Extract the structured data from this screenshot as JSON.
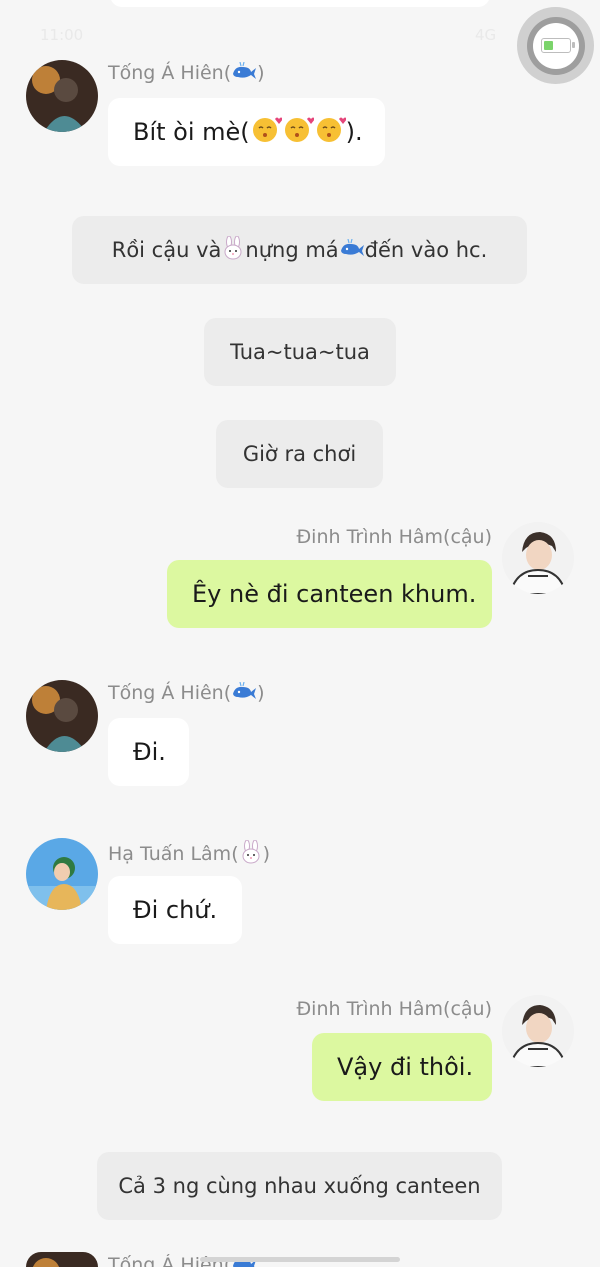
{
  "status_bar": {
    "time": "11:00",
    "signal": "4G"
  },
  "messages": [
    {
      "kind": "in",
      "name": "Tống Á Hiên(",
      "name_close": ")",
      "name_icon": "whale-icon",
      "text": "Bít òi mè(",
      "text_close": ").",
      "text_icons": [
        "kissing-heart-emoji",
        "kissing-heart-emoji",
        "kissing-heart-emoji"
      ],
      "avatar": "avatar-tong-a-hien"
    },
    {
      "kind": "sys",
      "parts": [
        "Rồi cậu và ",
        " nựng má ",
        " đến vào hc."
      ],
      "icons": [
        "rabbit-icon",
        "whale-icon"
      ]
    },
    {
      "kind": "sys",
      "text": "Tua~tua~tua"
    },
    {
      "kind": "sys",
      "text": "Giờ ra chơi"
    },
    {
      "kind": "out",
      "name": "Đinh Trình Hâm(cậu)",
      "text": "Êy nè đi canteen khum.",
      "avatar": "avatar-dinh-trinh-ham"
    },
    {
      "kind": "in",
      "name": "Tống Á Hiên(",
      "name_close": ")",
      "name_icon": "whale-icon",
      "text": "Đi.",
      "avatar": "avatar-tong-a-hien"
    },
    {
      "kind": "in",
      "name": "Hạ Tuấn Lâm(",
      "name_close": ")",
      "name_icon": "rabbit-icon",
      "text": "Đi chứ.",
      "avatar": "avatar-ha-tuan-lam"
    },
    {
      "kind": "out",
      "name": "Đinh Trình Hâm(cậu)",
      "text": "Vậy đi thôi.",
      "avatar": "avatar-dinh-trinh-ham"
    },
    {
      "kind": "sys",
      "text": "Cả 3 ng cùng nhau xuống canteen"
    },
    {
      "kind": "in",
      "name": "Tống Á Hiên(",
      "name_icon": "whale-icon",
      "avatar": "avatar-tong-a-hien"
    }
  ],
  "colors": {
    "background": "#f6f6f6",
    "incoming_bubble": "#ffffff",
    "outgoing_bubble": "#dcf8a0",
    "system_bubble": "#ececec",
    "name_text": "#8c8c8c"
  }
}
